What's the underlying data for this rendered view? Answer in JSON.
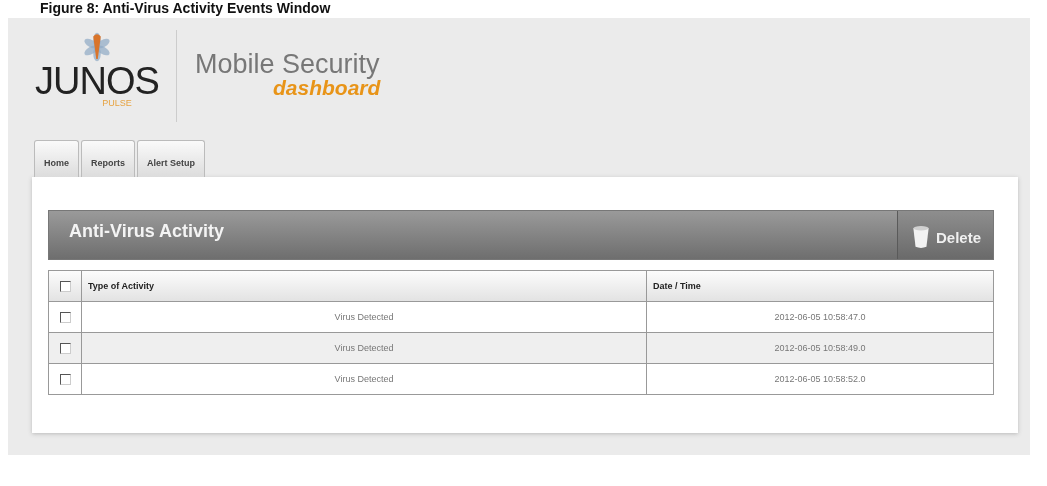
{
  "caption": "Figure 8: Anti-Virus Activity Events Window",
  "logo": {
    "wordmark": "JUNOS",
    "tagline": "PULSE"
  },
  "app_title": "Mobile Security",
  "app_subtitle": "dashboard",
  "tabs": [
    {
      "label": "Home"
    },
    {
      "label": "Reports"
    },
    {
      "label": "Alert Setup"
    }
  ],
  "panel": {
    "title": "Anti-Virus Activity",
    "delete_button": "Delete",
    "table": {
      "select_all": {
        "checked": false
      },
      "columns": [
        "Type of Activity",
        "Date / Time"
      ],
      "rows": [
        {
          "checked": false,
          "cells": [
            "Virus Detected",
            "2012-06-05  10:58:47.0"
          ]
        },
        {
          "checked": false,
          "cells": [
            "Virus Detected",
            "2012-06-05  10:58:49.0"
          ]
        },
        {
          "checked": false,
          "cells": [
            "Virus Detected",
            "2012-06-05  10:58:52.0"
          ]
        }
      ]
    }
  }
}
